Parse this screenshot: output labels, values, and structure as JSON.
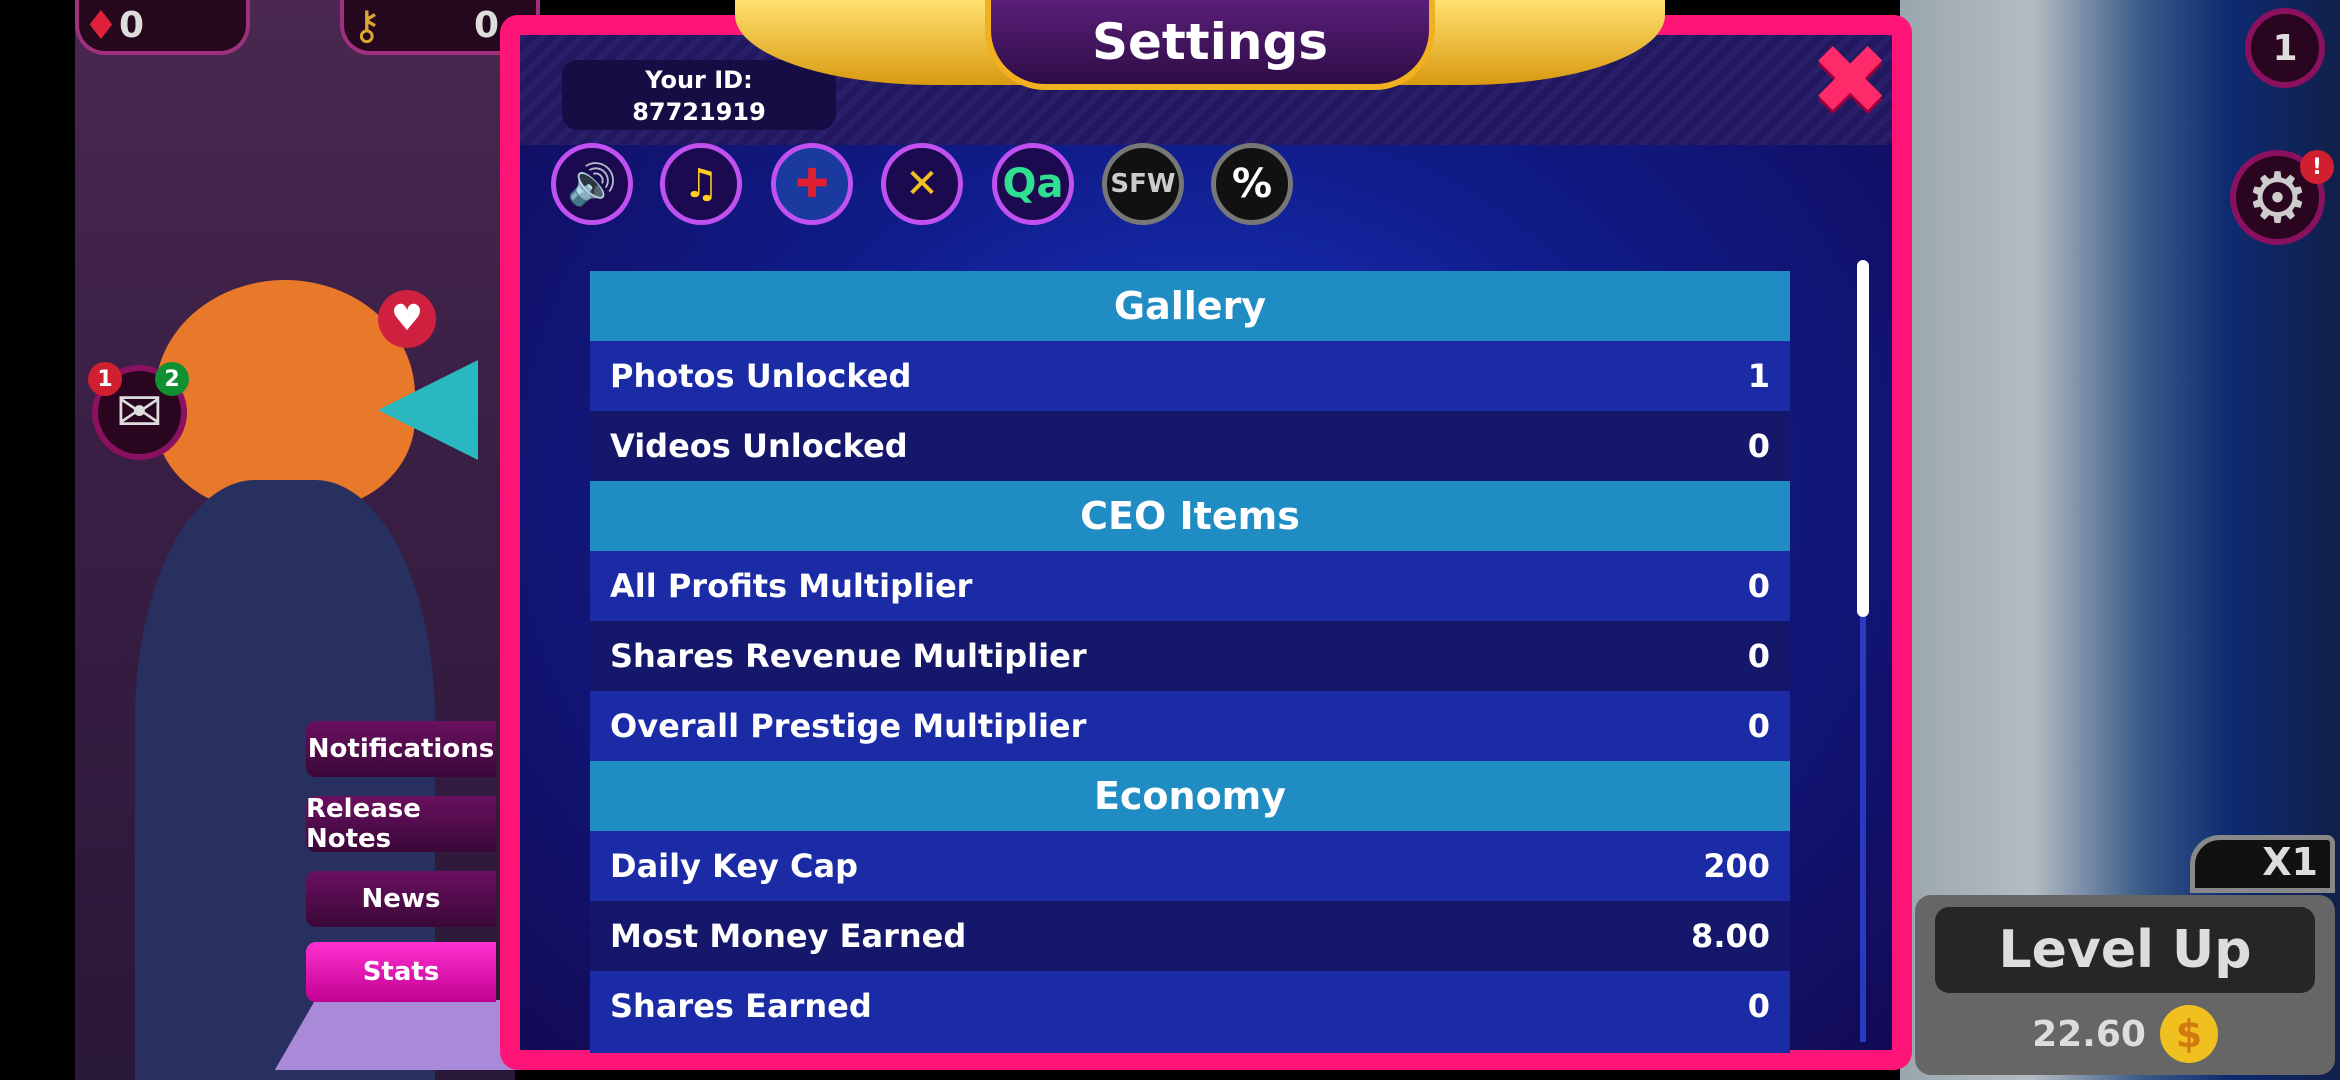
{
  "hud": {
    "gems": "0",
    "keys": "0",
    "level_badge": "1",
    "settings_alert": "!",
    "mail_badge_red": "1",
    "mail_badge_green": "2",
    "multiplier": "X1",
    "level_up_label": "Level Up",
    "level_up_cost": "22.60",
    "coin_symbol": "$"
  },
  "side_menu": [
    {
      "label": "Notifications",
      "active": false
    },
    {
      "label": "Release Notes",
      "active": false
    },
    {
      "label": "News",
      "active": false
    },
    {
      "label": "Stats",
      "active": true
    }
  ],
  "modal": {
    "title": "Settings",
    "id_label": "Your ID:",
    "id_value": "87721919",
    "close_symbol": "✖",
    "icons": [
      {
        "name": "sound-icon",
        "glyph": "🔊"
      },
      {
        "name": "music-icon",
        "glyph": "♫"
      },
      {
        "name": "language-uk-flag-icon",
        "glyph": "✚"
      },
      {
        "name": "coin-x-icon",
        "glyph": "✕"
      },
      {
        "name": "qa-icon",
        "glyph": "Qa"
      },
      {
        "name": "sfw-icon",
        "glyph": "SFW"
      },
      {
        "name": "percent-icon",
        "glyph": "%"
      }
    ],
    "stats": [
      {
        "type": "header",
        "label": "Gallery"
      },
      {
        "type": "row",
        "label": "Photos Unlocked",
        "value": "1"
      },
      {
        "type": "row",
        "label": "Videos Unlocked",
        "value": "0"
      },
      {
        "type": "header",
        "label": "CEO Items"
      },
      {
        "type": "row",
        "label": "All Profits Multiplier",
        "value": "0"
      },
      {
        "type": "row",
        "label": "Shares Revenue Multiplier",
        "value": "0"
      },
      {
        "type": "row",
        "label": "Overall Prestige Multiplier",
        "value": "0"
      },
      {
        "type": "header",
        "label": "Economy"
      },
      {
        "type": "row",
        "label": "Daily Key Cap",
        "value": "200"
      },
      {
        "type": "row",
        "label": "Most Money Earned",
        "value": "8.00"
      },
      {
        "type": "row",
        "label": "Shares Earned",
        "value": "0"
      }
    ]
  },
  "colors": {
    "modal_border": "#ff1478",
    "section_header": "#1f8cc4",
    "active_menu": "#ff30d0"
  }
}
